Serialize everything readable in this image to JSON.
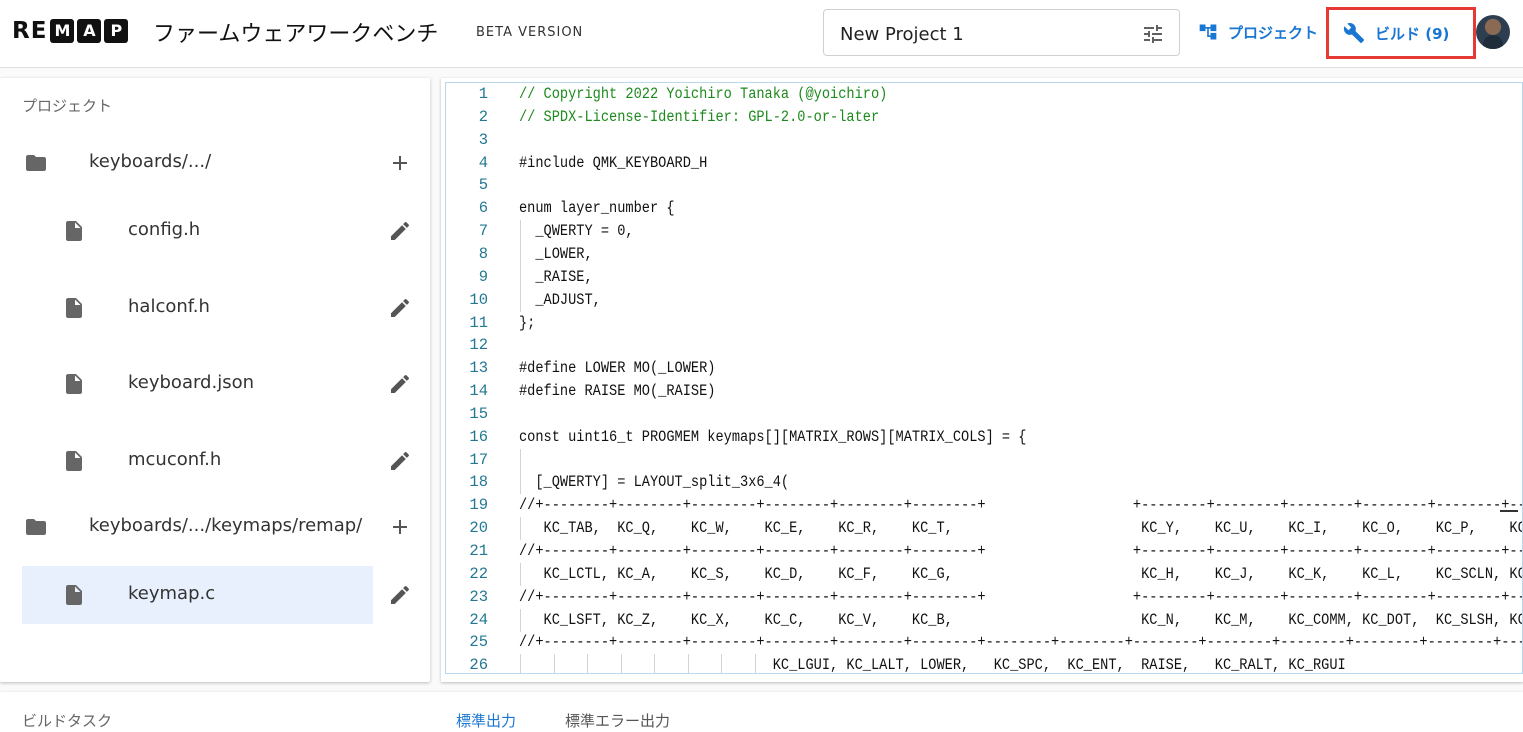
{
  "header": {
    "logo_re": "RE",
    "logo_letters": [
      "M",
      "A",
      "P"
    ],
    "title": "ファームウェアワークベンチ",
    "beta_label": "BETA VERSION",
    "project_name": "New Project 1",
    "nav_project_label": "プロジェクト",
    "nav_build_label": "ビルド (9)",
    "icons": {
      "settings": "tune-icon",
      "project": "account-tree-icon",
      "build": "wrench-icon"
    },
    "accent_color": "#1976d2",
    "highlight_color": "#e53935"
  },
  "sidebar": {
    "heading": "プロジェクト",
    "items": [
      {
        "type": "folder",
        "label": "keyboards/.../",
        "action": "add"
      },
      {
        "type": "file",
        "label": "config.h",
        "action": "edit"
      },
      {
        "type": "file",
        "label": "halconf.h",
        "action": "edit"
      },
      {
        "type": "file",
        "label": "keyboard.json",
        "action": "edit"
      },
      {
        "type": "file",
        "label": "mcuconf.h",
        "action": "edit"
      },
      {
        "type": "folder",
        "label": "keyboards/.../keymaps/remap/",
        "action": "add"
      },
      {
        "type": "file",
        "label": "keymap.c",
        "action": "edit",
        "selected": true
      }
    ]
  },
  "editor": {
    "lines": [
      {
        "n": "1",
        "text": "// Copyright 2022 Yoichiro Tanaka (@yoichiro)",
        "kind": "comment"
      },
      {
        "n": "2",
        "text": "// SPDX-License-Identifier: GPL-2.0-or-later",
        "kind": "comment"
      },
      {
        "n": "3",
        "text": "",
        "kind": "code"
      },
      {
        "n": "4",
        "text": "#include QMK_KEYBOARD_H",
        "kind": "code"
      },
      {
        "n": "5",
        "text": "",
        "kind": "code"
      },
      {
        "n": "6",
        "text": "enum layer_number {",
        "kind": "code"
      },
      {
        "n": "7",
        "text": "  _QWERTY = 0,",
        "kind": "code"
      },
      {
        "n": "8",
        "text": "  _LOWER,",
        "kind": "code"
      },
      {
        "n": "9",
        "text": "  _RAISE,",
        "kind": "code"
      },
      {
        "n": "10",
        "text": "  _ADJUST,",
        "kind": "code"
      },
      {
        "n": "11",
        "text": "};",
        "kind": "code"
      },
      {
        "n": "12",
        "text": "",
        "kind": "code"
      },
      {
        "n": "13",
        "text": "#define LOWER MO(_LOWER)",
        "kind": "code"
      },
      {
        "n": "14",
        "text": "#define RAISE MO(_RAISE)",
        "kind": "code"
      },
      {
        "n": "15",
        "text": "",
        "kind": "code"
      },
      {
        "n": "16",
        "text": "const uint16_t PROGMEM keymaps[][MATRIX_ROWS][MATRIX_COLS] = {",
        "kind": "code"
      },
      {
        "n": "17",
        "text": "",
        "kind": "code"
      },
      {
        "n": "18",
        "text": "  [_QWERTY] = LAYOUT_split_3x6_4(",
        "kind": "code"
      },
      {
        "n": "19",
        "text": "//+--------+--------+--------+--------+--------+--------+                  +--------+--------+--------+--------+--------+--------+",
        "kind": "code"
      },
      {
        "n": "20",
        "text": "   KC_TAB,  KC_Q,    KC_W,    KC_E,    KC_R,    KC_T,                       KC_Y,    KC_U,    KC_I,    KC_O,    KC_P,    KC_BSPC,",
        "kind": "code"
      },
      {
        "n": "21",
        "text": "//+--------+--------+--------+--------+--------+--------+                  +--------+--------+--------+--------+--------+--------+",
        "kind": "code"
      },
      {
        "n": "22",
        "text": "   KC_LCTL, KC_A,    KC_S,    KC_D,    KC_F,    KC_G,                       KC_H,    KC_J,    KC_K,    KC_L,    KC_SCLN, KC_QUOT,",
        "kind": "code"
      },
      {
        "n": "23",
        "text": "//+--------+--------+--------+--------+--------+--------+                  +--------+--------+--------+--------+--------+--------+",
        "kind": "code"
      },
      {
        "n": "24",
        "text": "   KC_LSFT, KC_Z,    KC_X,    KC_C,    KC_V,    KC_B,                       KC_N,    KC_M,    KC_COMM, KC_DOT,  KC_SLSH, KC_RSFT,",
        "kind": "code"
      },
      {
        "n": "25",
        "text": "//+--------+--------+--------+--------+--------+--------+--------+--------+--------+--------+--------+--------+--------+--------+",
        "kind": "code"
      },
      {
        "n": "26",
        "text": "                               KC_LGUI, KC_LALT, LOWER,   KC_SPC,  KC_ENT,  RAISE,   KC_RALT, KC_RGUI",
        "kind": "code"
      }
    ]
  },
  "bottom": {
    "heading": "ビルドタスク",
    "tabs": [
      {
        "label": "標準出力",
        "active": true
      },
      {
        "label": "標準エラー出力",
        "active": false
      }
    ]
  }
}
